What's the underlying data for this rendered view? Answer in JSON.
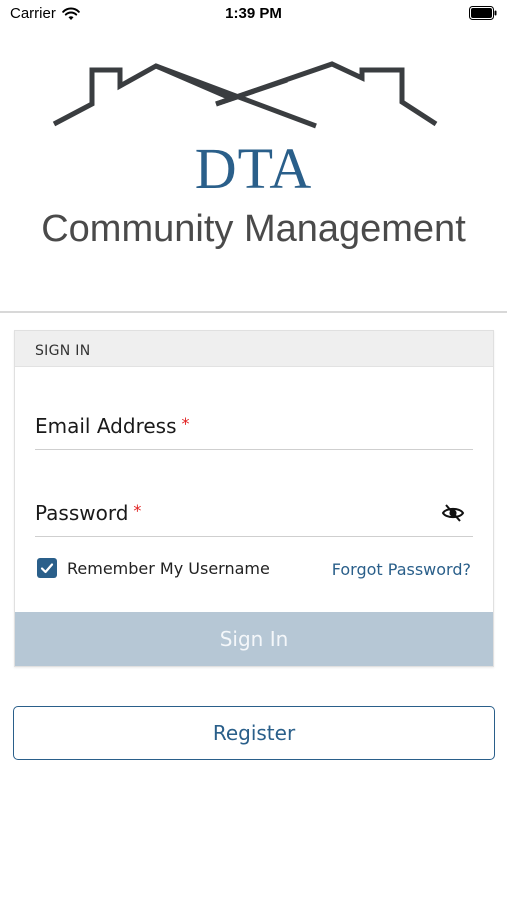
{
  "status_bar": {
    "carrier": "Carrier",
    "time": "1:39 PM",
    "wifi_icon": "wifi-icon",
    "battery_icon": "battery-icon"
  },
  "logo": {
    "title": "DTA",
    "subtitle": "Community Management",
    "brand_color": "#2a5f8a",
    "roof_color": "#3a3d40"
  },
  "sign_in": {
    "header": "SIGN IN",
    "email": {
      "label": "Email Address",
      "required_mark": "*",
      "value": ""
    },
    "password": {
      "label": "Password",
      "required_mark": "*",
      "value": "",
      "toggle_icon": "eye-slash-icon"
    },
    "remember": {
      "label": "Remember My Username",
      "checked": true
    },
    "forgot_label": "Forgot Password?",
    "submit_label": "Sign In"
  },
  "register_label": "Register",
  "colors": {
    "accent": "#2a5f8a",
    "required": "#e02020",
    "disabled_button": "#b6c7d5"
  }
}
